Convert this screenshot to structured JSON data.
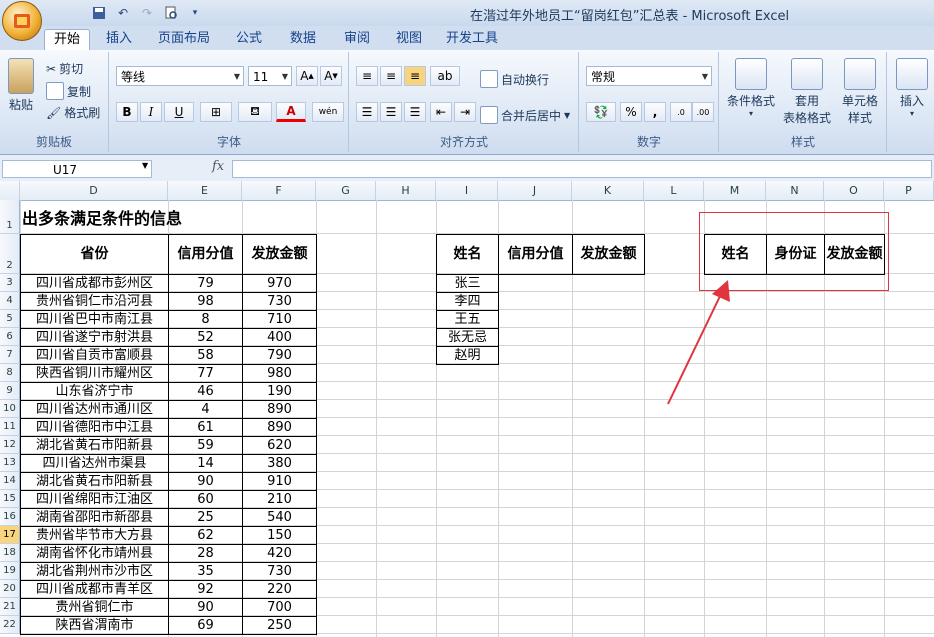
{
  "window": {
    "title": "在湝过年外地员工“留岗红包”汇总表 - Microsoft Excel"
  },
  "tabs": [
    "开始",
    "插入",
    "页面布局",
    "公式",
    "数据",
    "审阅",
    "视图",
    "开发工具"
  ],
  "ribbon": {
    "clipboard": {
      "paste": "粘贴",
      "cut": "剪切",
      "copy": "复制",
      "format_painter": "格式刷",
      "label": "剪贴板"
    },
    "font": {
      "name": "等线",
      "size": "11",
      "label": "字体",
      "bold": "B",
      "italic": "I",
      "underline": "U",
      "color_letter": "A",
      "phonetic": "wén"
    },
    "alignment": {
      "wrap": "自动换行",
      "merge": "合并后居中",
      "label": "对齐方式"
    },
    "number": {
      "format": "常规",
      "percent": "%",
      "comma": ",",
      "label": "数字"
    },
    "styles": {
      "conditional": "条件格式",
      "table": "套用",
      "table2": "表格格式",
      "cell": "单元格",
      "cell2": "样式",
      "label": "样式"
    },
    "cells": {
      "insert": "插入"
    }
  },
  "formula_bar": {
    "name_box": "U17",
    "fx": "fx",
    "value": ""
  },
  "columns": [
    "D",
    "E",
    "F",
    "G",
    "H",
    "I",
    "J",
    "K",
    "L",
    "M",
    "N",
    "O",
    "P"
  ],
  "rows": [
    "1",
    "2",
    "3",
    "4",
    "5",
    "6",
    "7",
    "8",
    "9",
    "10",
    "11",
    "12",
    "13",
    "14",
    "15",
    "16",
    "17",
    "18",
    "19",
    "20",
    "21",
    "22"
  ],
  "selected_row": "17",
  "sheet": {
    "title": "出多条满足条件的信息",
    "main_table": {
      "headers": [
        "省份",
        "信用分值",
        "发放金额"
      ],
      "rows": [
        [
          "四川省成都市彭州区",
          "79",
          "970"
        ],
        [
          "贵州省铜仁市沿河县",
          "98",
          "730"
        ],
        [
          "四川省巴中市南江县",
          "8",
          "710"
        ],
        [
          "四川省遂宁市射洪县",
          "52",
          "400"
        ],
        [
          "四川省自贡市富顺县",
          "58",
          "790"
        ],
        [
          "陕西省铜川市耀州区",
          "77",
          "980"
        ],
        [
          "山东省济宁市",
          "46",
          "190"
        ],
        [
          "四川省达州市通川区",
          "4",
          "890"
        ],
        [
          "四川省德阳市中江县",
          "61",
          "890"
        ],
        [
          "湖北省黄石市阳新县",
          "59",
          "620"
        ],
        [
          "四川省达州市渠县",
          "14",
          "380"
        ],
        [
          "湖北省黄石市阳新县",
          "90",
          "910"
        ],
        [
          "四川省绵阳市江油区",
          "60",
          "210"
        ],
        [
          "湖南省邵阳市新邵县",
          "25",
          "540"
        ],
        [
          "贵州省毕节市大方县",
          "62",
          "150"
        ],
        [
          "湖南省怀化市靖州县",
          "28",
          "420"
        ],
        [
          "湖北省荆州市沙市区",
          "35",
          "730"
        ],
        [
          "四川省成都市青羊区",
          "92",
          "220"
        ],
        [
          "贵州省铜仁市",
          "90",
          "700"
        ],
        [
          "陕西省渭南市",
          "69",
          "250"
        ]
      ]
    },
    "lookup_table": {
      "headers": [
        "姓名",
        "信用分值",
        "发放金额"
      ],
      "names": [
        "张三",
        "李四",
        "王五",
        "张无忌",
        "赵明"
      ]
    },
    "result_table": {
      "headers": [
        "姓名",
        "身份证",
        "发放金额"
      ]
    }
  },
  "colors": {
    "annotation_red": "#e0343f",
    "selected_row_header": "#f8d47e"
  }
}
